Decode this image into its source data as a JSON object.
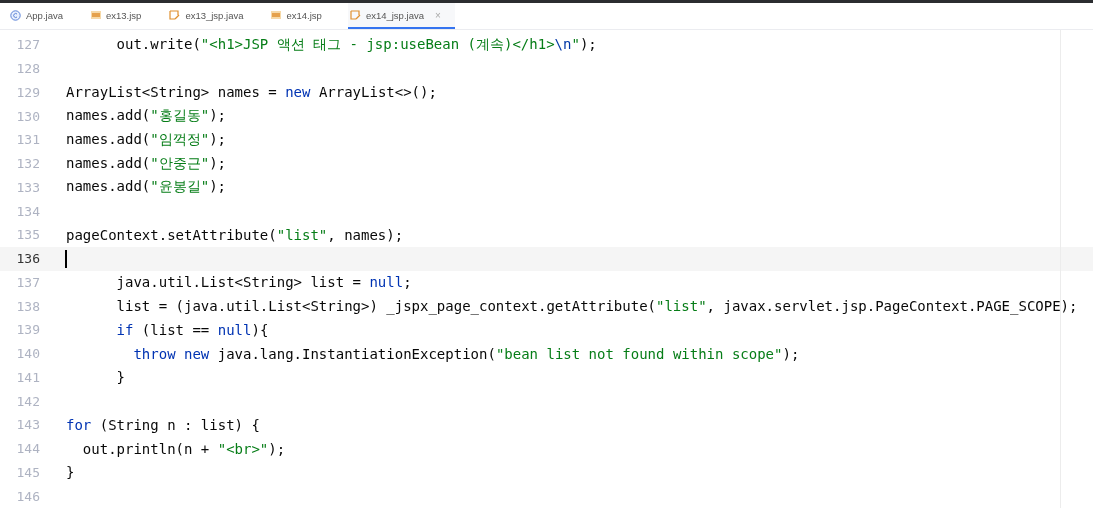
{
  "tabs": [
    {
      "label": "App.java",
      "kind": "class",
      "selected": false
    },
    {
      "label": "ex13.jsp",
      "kind": "jsp",
      "selected": false
    },
    {
      "label": "ex13_jsp.java",
      "kind": "generated",
      "selected": false
    },
    {
      "label": "ex14.jsp",
      "kind": "jsp",
      "selected": false
    },
    {
      "label": "ex14_jsp.java",
      "kind": "generated",
      "selected": true,
      "close": "×"
    }
  ],
  "lines": [
    {
      "number": "127",
      "current": false,
      "tokens": [
        {
          "kind": "plain",
          "text": "      out.write("
        },
        {
          "kind": "str",
          "text": "\"<h1>JSP 액션 태그 - jsp:useBean (계속)</h1>"
        },
        {
          "kind": "esc",
          "text": "\\n"
        },
        {
          "kind": "str",
          "text": "\""
        },
        {
          "kind": "plain",
          "text": ");"
        }
      ]
    },
    {
      "number": "128",
      "current": false
    },
    {
      "number": "129",
      "current": false,
      "tokens": [
        {
          "kind": "plain",
          "text": "ArrayList<String> names = "
        },
        {
          "kind": "kw",
          "text": "new"
        },
        {
          "kind": "plain",
          "text": " ArrayList<>();"
        }
      ]
    },
    {
      "number": "130",
      "current": false,
      "tokens": [
        {
          "kind": "plain",
          "text": "names.add("
        },
        {
          "kind": "str",
          "text": "\"홍길동\""
        },
        {
          "kind": "plain",
          "text": ");"
        }
      ]
    },
    {
      "number": "131",
      "current": false,
      "tokens": [
        {
          "kind": "plain",
          "text": "names.add("
        },
        {
          "kind": "str",
          "text": "\"임꺽정\""
        },
        {
          "kind": "plain",
          "text": ");"
        }
      ]
    },
    {
      "number": "132",
      "current": false,
      "tokens": [
        {
          "kind": "plain",
          "text": "names.add("
        },
        {
          "kind": "str",
          "text": "\"안중근\""
        },
        {
          "kind": "plain",
          "text": ");"
        }
      ]
    },
    {
      "number": "133",
      "current": false,
      "tokens": [
        {
          "kind": "plain",
          "text": "names.add("
        },
        {
          "kind": "str",
          "text": "\"윤봉길\""
        },
        {
          "kind": "plain",
          "text": ");"
        }
      ]
    },
    {
      "number": "134",
      "current": false
    },
    {
      "number": "135",
      "current": false,
      "tokens": [
        {
          "kind": "plain",
          "text": "pageContext.setAttribute("
        },
        {
          "kind": "str",
          "text": "\"list\""
        },
        {
          "kind": "plain",
          "text": ", names);"
        }
      ]
    },
    {
      "number": "136",
      "current": true
    },
    {
      "number": "137",
      "current": false,
      "tokens": [
        {
          "kind": "plain",
          "text": "      java.util.List<String> list = "
        },
        {
          "kind": "kw",
          "text": "null"
        },
        {
          "kind": "plain",
          "text": ";"
        }
      ]
    },
    {
      "number": "138",
      "current": false,
      "tokens": [
        {
          "kind": "plain",
          "text": "      list = (java.util.List<String>) _jspx_page_context.getAttribute("
        },
        {
          "kind": "str",
          "text": "\"list\""
        },
        {
          "kind": "plain",
          "text": ", javax.servlet.jsp.PageContext.PAGE_SCOPE);"
        }
      ]
    },
    {
      "number": "139",
      "current": false,
      "tokens": [
        {
          "kind": "kw",
          "text": "      if"
        },
        {
          "kind": "plain",
          "text": " (list == "
        },
        {
          "kind": "kw",
          "text": "null"
        },
        {
          "kind": "plain",
          "text": "){"
        }
      ]
    },
    {
      "number": "140",
      "current": false,
      "tokens": [
        {
          "kind": "kw",
          "text": "        throw new"
        },
        {
          "kind": "plain",
          "text": " java.lang.InstantiationException("
        },
        {
          "kind": "str",
          "text": "\"bean list not found within scope\""
        },
        {
          "kind": "plain",
          "text": ");"
        }
      ]
    },
    {
      "number": "141",
      "current": false,
      "tokens": [
        {
          "kind": "plain",
          "text": "      }"
        }
      ]
    },
    {
      "number": "142",
      "current": false
    },
    {
      "number": "143",
      "current": false,
      "tokens": [
        {
          "kind": "kw",
          "text": "for"
        },
        {
          "kind": "plain",
          "text": " (String n : list) {"
        }
      ]
    },
    {
      "number": "144",
      "current": false,
      "tokens": [
        {
          "kind": "plain",
          "text": "  out.println(n + "
        },
        {
          "kind": "str",
          "text": "\"<br>\""
        },
        {
          "kind": "plain",
          "text": ");"
        }
      ]
    },
    {
      "number": "145",
      "current": false,
      "tokens": [
        {
          "kind": "plain",
          "text": "}"
        }
      ]
    },
    {
      "number": "146",
      "current": false
    }
  ]
}
